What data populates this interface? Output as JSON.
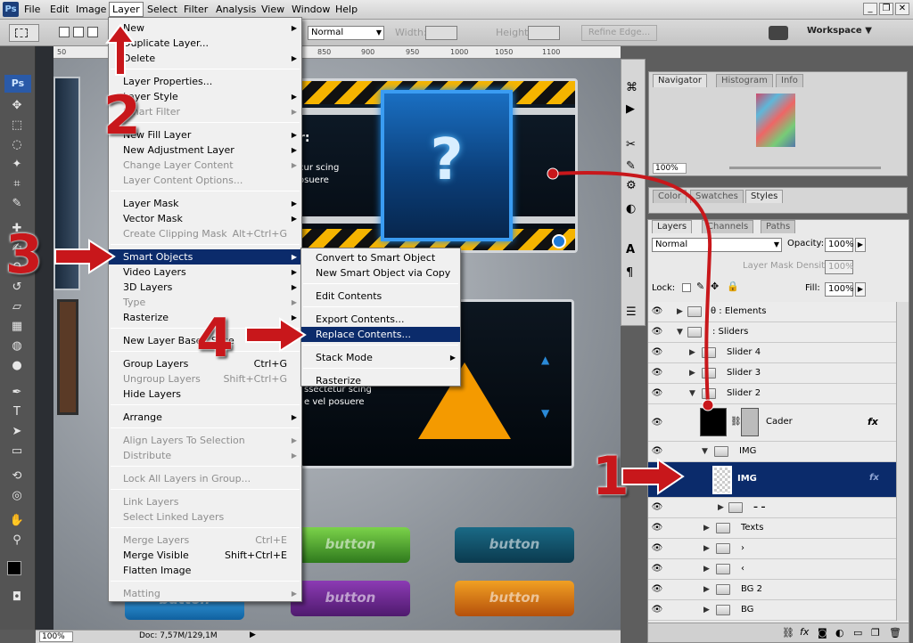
{
  "menubar": {
    "items": [
      "File",
      "Edit",
      "Image",
      "Layer",
      "Select",
      "Filter",
      "Analysis",
      "View",
      "Window",
      "Help"
    ],
    "active": "Layer",
    "app_icon": "Ps"
  },
  "options": {
    "blend_mode": "Normal",
    "width_label": "Width:",
    "height_label": "Height:",
    "refine_edge": "Refine Edge...",
    "workspace": "Workspace"
  },
  "toolbox": {
    "logo": "Ps"
  },
  "ruler": {
    "ticks": [
      "50",
      "850",
      "900",
      "950",
      "1000",
      "1050",
      "1100"
    ]
  },
  "artboard": {
    "panel1_text": [
      "r:",
      "cur scing",
      "osuere"
    ],
    "question_mark": "?",
    "panel2_text": [
      "ssectetur scing",
      "e vel posuere"
    ],
    "buttons": [
      "button",
      "button",
      "button",
      "button",
      "button",
      "button"
    ],
    "number_left": "2"
  },
  "status": {
    "zoom": "100%",
    "doc": "Doc: 7,57M/129,1M"
  },
  "navigator": {
    "tabs": [
      "Navigator",
      "Histogram",
      "Info"
    ],
    "zoom": "100%"
  },
  "styles_tabs": [
    "Color",
    "Swatches",
    "Styles"
  ],
  "layers_panel": {
    "tabs": [
      "Layers",
      "Channels",
      "Paths"
    ],
    "blend": "Normal",
    "opacity_label": "Opacity:",
    "opacity": "100%",
    "mask_density_label": "Layer Mask Density",
    "mask_density": "100%",
    "lock_label": "Lock:",
    "fill_label": "Fill:",
    "fill": "100%",
    "rows": [
      {
        "name": "θ : Elements"
      },
      {
        "name": ": Sliders"
      },
      {
        "name": "Slider 4"
      },
      {
        "name": "Slider 3"
      },
      {
        "name": "Slider 2"
      },
      {
        "name": "Cader"
      },
      {
        "name": "IMG"
      },
      {
        "name": "IMG"
      },
      {
        "name": "– –"
      },
      {
        "name": "Texts"
      },
      {
        "name": "›"
      },
      {
        "name": "‹"
      },
      {
        "name": "BG 2"
      },
      {
        "name": "BG"
      }
    ],
    "fx": "fx"
  },
  "layer_menu": {
    "items": [
      {
        "label": "New",
        "arrow": true
      },
      {
        "label": "Duplicate Layer..."
      },
      {
        "label": "Delete",
        "arrow": true
      },
      {
        "sep": true
      },
      {
        "label": "Layer Properties..."
      },
      {
        "label": "Layer Style",
        "arrow": true
      },
      {
        "label": "Smart Filter",
        "dis": true,
        "arrow": true
      },
      {
        "sep": true
      },
      {
        "label": "New Fill Layer",
        "arrow": true
      },
      {
        "label": "New Adjustment Layer",
        "arrow": true
      },
      {
        "label": "Change Layer Content",
        "dis": true,
        "arrow": true
      },
      {
        "label": "Layer Content Options...",
        "dis": true
      },
      {
        "sep": true
      },
      {
        "label": "Layer Mask",
        "arrow": true
      },
      {
        "label": "Vector Mask",
        "arrow": true
      },
      {
        "label": "Create Clipping Mask",
        "dis": true,
        "shortcut": "Alt+Ctrl+G"
      },
      {
        "sep": true
      },
      {
        "label": "Smart Objects",
        "arrow": true,
        "hl": true
      },
      {
        "label": "Video Layers",
        "arrow": true
      },
      {
        "label": "3D Layers",
        "arrow": true
      },
      {
        "label": "Type",
        "dis": true,
        "arrow": true
      },
      {
        "label": "Rasterize",
        "arrow": true
      },
      {
        "sep": true
      },
      {
        "label": "New Layer Based Slice"
      },
      {
        "sep": true
      },
      {
        "label": "Group Layers",
        "shortcut": "Ctrl+G"
      },
      {
        "label": "Ungroup Layers",
        "dis": true,
        "shortcut": "Shift+Ctrl+G"
      },
      {
        "label": "Hide Layers"
      },
      {
        "sep": true
      },
      {
        "label": "Arrange",
        "arrow": true
      },
      {
        "sep": true
      },
      {
        "label": "Align Layers To Selection",
        "dis": true,
        "arrow": true
      },
      {
        "label": "Distribute",
        "dis": true,
        "arrow": true
      },
      {
        "sep": true
      },
      {
        "label": "Lock All Layers in Group...",
        "dis": true
      },
      {
        "sep": true
      },
      {
        "label": "Link Layers",
        "dis": true
      },
      {
        "label": "Select Linked Layers",
        "dis": true
      },
      {
        "sep": true
      },
      {
        "label": "Merge Layers",
        "dis": true,
        "shortcut": "Ctrl+E"
      },
      {
        "label": "Merge Visible",
        "shortcut": "Shift+Ctrl+E"
      },
      {
        "label": "Flatten Image"
      },
      {
        "sep": true
      },
      {
        "label": "Matting",
        "dis": true,
        "arrow": true
      }
    ]
  },
  "smart_submenu": {
    "items": [
      {
        "label": "Convert to Smart Object"
      },
      {
        "label": "New Smart Object via Copy"
      },
      {
        "sep": true
      },
      {
        "label": "Edit Contents"
      },
      {
        "sep": true
      },
      {
        "label": "Export Contents..."
      },
      {
        "label": "Replace Contents...",
        "hl": true
      },
      {
        "sep": true
      },
      {
        "label": "Stack Mode",
        "arrow": true
      },
      {
        "sep": true
      },
      {
        "label": "Rasterize"
      }
    ]
  },
  "annotations": [
    "1",
    "2",
    "3",
    "4"
  ],
  "colors": {
    "highlight": "#0b2b6b",
    "annotation": "#c8171b"
  }
}
